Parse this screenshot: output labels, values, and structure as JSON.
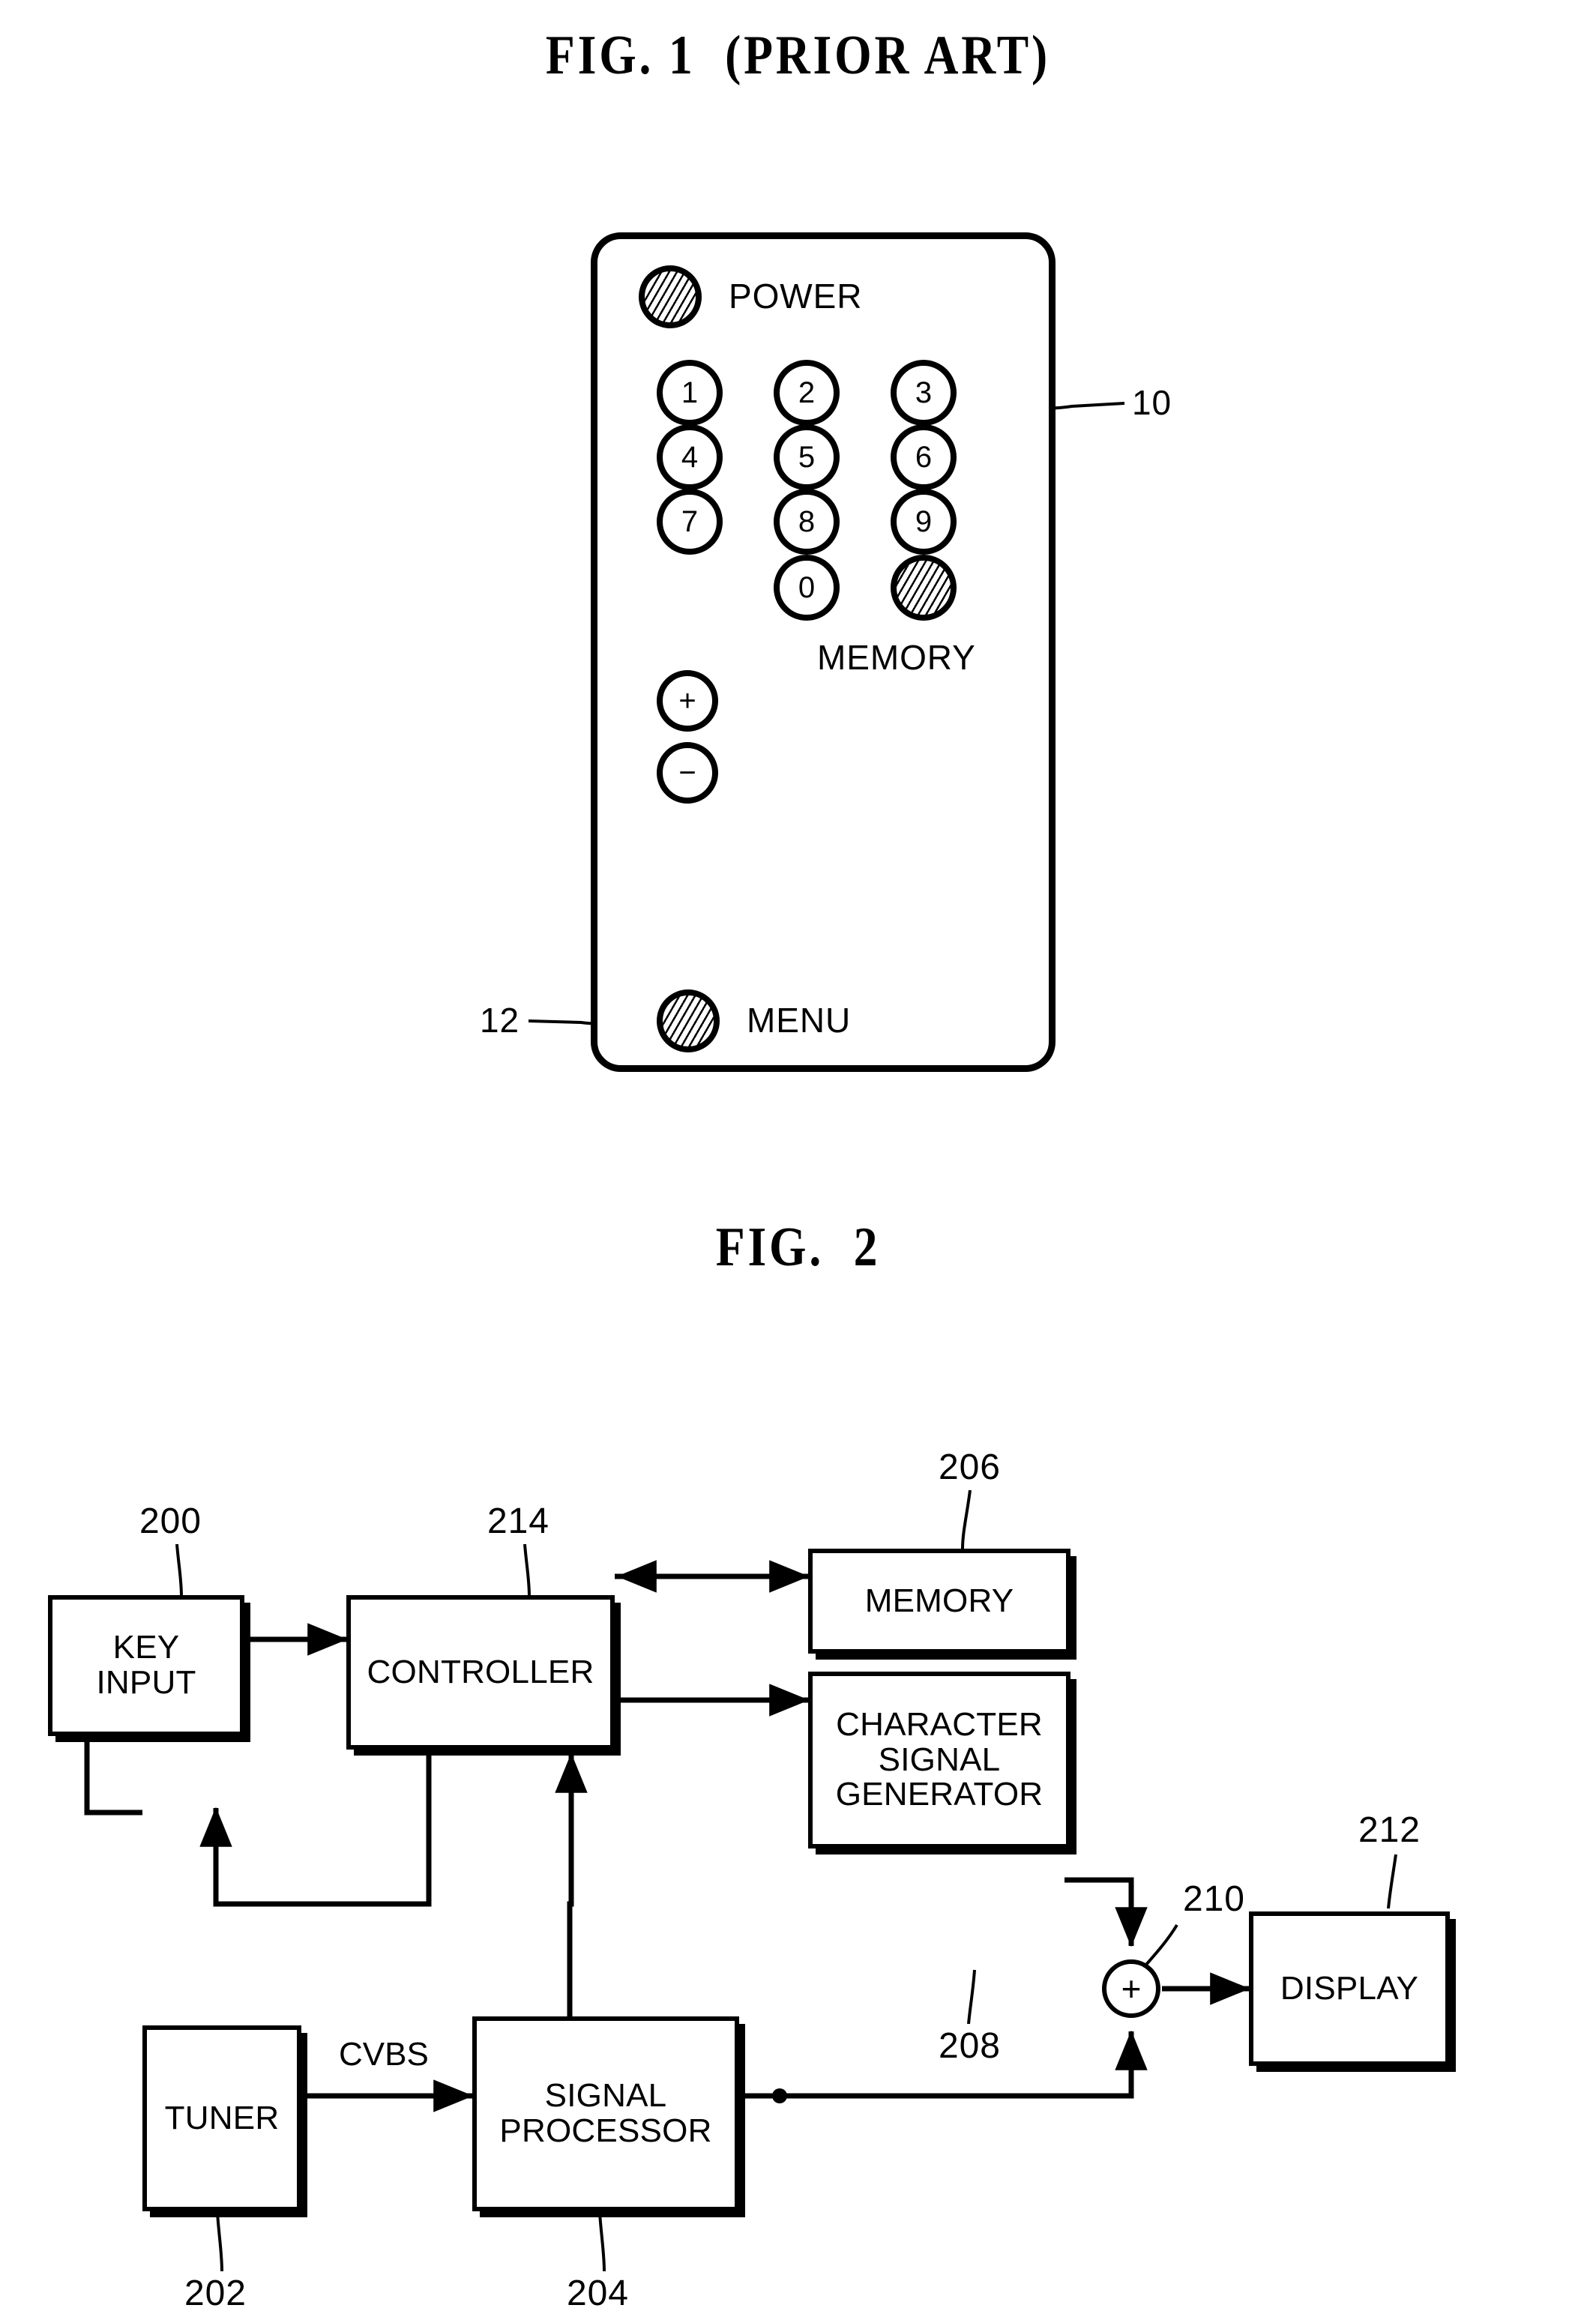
{
  "figures": {
    "fig1": {
      "title": "FIG. 1  (PRIOR ART)",
      "device": "tv-remote-control",
      "buttons": [
        {
          "key": "power",
          "label": "POWER",
          "shape": "circle",
          "fill": "hatched"
        },
        {
          "key": "num1",
          "label": "1",
          "shape": "circle",
          "fill": "none"
        },
        {
          "key": "num2",
          "label": "2",
          "shape": "circle",
          "fill": "none"
        },
        {
          "key": "num3",
          "label": "3",
          "shape": "circle",
          "fill": "none"
        },
        {
          "key": "num4",
          "label": "4",
          "shape": "circle",
          "fill": "none"
        },
        {
          "key": "num5",
          "label": "5",
          "shape": "circle",
          "fill": "none"
        },
        {
          "key": "num6",
          "label": "6",
          "shape": "circle",
          "fill": "none"
        },
        {
          "key": "num7",
          "label": "7",
          "shape": "circle",
          "fill": "none"
        },
        {
          "key": "num8",
          "label": "8",
          "shape": "circle",
          "fill": "none"
        },
        {
          "key": "num9",
          "label": "9",
          "shape": "circle",
          "fill": "none"
        },
        {
          "key": "num0",
          "label": "0",
          "shape": "circle",
          "fill": "none"
        },
        {
          "key": "memory",
          "label": "MEMORY",
          "shape": "circle",
          "fill": "hatched"
        },
        {
          "key": "volume_up",
          "label": "+",
          "shape": "circle",
          "fill": "none"
        },
        {
          "key": "volume_down",
          "label": "−",
          "shape": "circle",
          "fill": "none"
        },
        {
          "key": "menu",
          "label": "MENU",
          "shape": "circle",
          "fill": "hatched"
        }
      ],
      "labels": {
        "power": "POWER",
        "memory": "MEMORY",
        "menu": "MENU",
        "plus": "+",
        "minus": "−",
        "n1": "1",
        "n2": "2",
        "n3": "3",
        "n4": "4",
        "n5": "5",
        "n6": "6",
        "n7": "7",
        "n8": "8",
        "n9": "9",
        "n0": "0"
      },
      "reference_numerals": [
        {
          "id": "ref10",
          "value": "10",
          "points_to": "memory-button"
        },
        {
          "id": "ref12",
          "value": "12",
          "points_to": "menu-button"
        }
      ]
    },
    "fig2": {
      "title": "FIG.  2",
      "diagram_type": "block-diagram",
      "blocks": [
        {
          "id": "key_input",
          "label": "KEY\nINPUT",
          "ref": "200"
        },
        {
          "id": "controller",
          "label": "CONTROLLER",
          "ref": "214"
        },
        {
          "id": "memory",
          "label": "MEMORY",
          "ref": "206"
        },
        {
          "id": "character_signal_generator",
          "label": "CHARACTER\nSIGNAL\nGENERATOR",
          "ref": "208"
        },
        {
          "id": "adder",
          "label": "+",
          "ref": "210"
        },
        {
          "id": "display",
          "label": "DISPLAY",
          "ref": "212"
        },
        {
          "id": "tuner",
          "label": "TUNER",
          "ref": "202"
        },
        {
          "id": "signal_processor",
          "label": "SIGNAL\nPROCESSOR",
          "ref": "204"
        }
      ],
      "signal_labels": [
        {
          "id": "cvbs",
          "label": "CVBS",
          "between": "tuner -> signal_processor"
        }
      ],
      "reference_numerals": {
        "key_input": "200",
        "tuner": "202",
        "signal_processor": "204",
        "memory": "206",
        "character_signal_generator": "208",
        "adder": "210",
        "display": "212",
        "controller": "214"
      },
      "connections": [
        {
          "from": "antenna",
          "to": "tuner",
          "type": "arrow"
        },
        {
          "from": "key_input",
          "to": "controller",
          "type": "arrow"
        },
        {
          "from": "controller",
          "to": "memory",
          "type": "bidirectional"
        },
        {
          "from": "controller",
          "to": "character_signal_generator",
          "type": "arrow"
        },
        {
          "from": "controller",
          "to": "tuner",
          "type": "arrow"
        },
        {
          "from": "tuner",
          "to": "signal_processor",
          "type": "arrow",
          "label": "CVBS"
        },
        {
          "from": "signal_processor",
          "to": "controller",
          "type": "arrow"
        },
        {
          "from": "signal_processor",
          "to": "adder",
          "type": "arrow"
        },
        {
          "from": "character_signal_generator",
          "to": "adder",
          "type": "arrow"
        },
        {
          "from": "adder",
          "to": "display",
          "type": "arrow"
        }
      ]
    }
  },
  "colors": {
    "ink": "#000000",
    "paper": "#ffffff"
  }
}
